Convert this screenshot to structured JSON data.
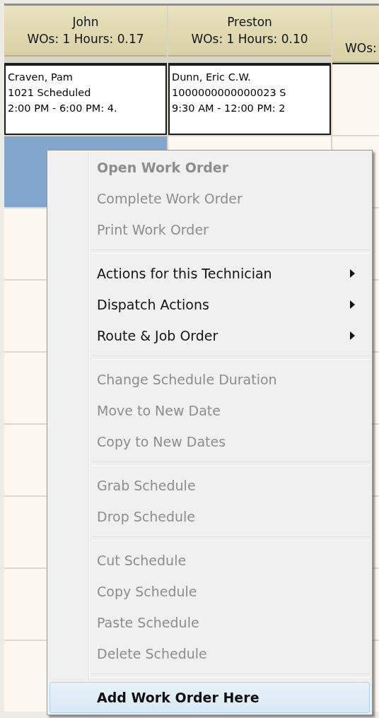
{
  "columns": [
    {
      "name": "John",
      "summary": "WOs: 1 Hours: 0.17"
    },
    {
      "name": "Preston",
      "summary": "WOs: 1 Hours: 0.10"
    },
    {
      "summary": "WOs:"
    }
  ],
  "job_row": [
    {
      "lines": [
        "Craven, Pam",
        "1021 Scheduled",
        "2:00 PM - 6:00 PM: 4."
      ]
    },
    {
      "lines": [
        "Dunn, Eric C.W.",
        "1000000000000023 S",
        "9:30 AM - 12:00 PM: 2"
      ]
    }
  ],
  "slot_rows": [
    {
      "cells": [
        {
          "selected": true
        },
        {
          "selected": false
        },
        {
          "selected": false
        }
      ]
    },
    {
      "cells": [
        {
          "selected": false
        },
        {
          "selected": false
        }
      ]
    },
    {
      "cells": [
        {
          "selected": false
        },
        {
          "selected": false
        }
      ]
    },
    {
      "cells": [
        {
          "selected": false
        },
        {
          "selected": false
        }
      ]
    },
    {
      "cells": [
        {
          "selected": false
        },
        {
          "selected": false
        }
      ]
    },
    {
      "cells": [
        {
          "selected": false
        },
        {
          "selected": false
        }
      ]
    },
    {
      "cells": [
        {
          "selected": false
        },
        {
          "selected": false
        }
      ]
    },
    {
      "cells": [
        {
          "selected": false
        },
        {
          "selected": false
        }
      ]
    }
  ],
  "context_menu": [
    {
      "kind": "item",
      "label": "Open Work Order",
      "disabled": true,
      "default": true,
      "submenu": false,
      "selected": false
    },
    {
      "kind": "item",
      "label": "Complete Work Order",
      "disabled": true,
      "default": false,
      "submenu": false,
      "selected": false
    },
    {
      "kind": "item",
      "label": "Print Work Order",
      "disabled": true,
      "default": false,
      "submenu": false,
      "selected": false
    },
    {
      "kind": "separator"
    },
    {
      "kind": "item",
      "label": "Actions for this Technician",
      "disabled": false,
      "default": false,
      "submenu": true,
      "selected": false
    },
    {
      "kind": "item",
      "label": "Dispatch Actions",
      "disabled": false,
      "default": false,
      "submenu": true,
      "selected": false
    },
    {
      "kind": "item",
      "label": "Route & Job Order",
      "disabled": false,
      "default": false,
      "submenu": true,
      "selected": false
    },
    {
      "kind": "separator"
    },
    {
      "kind": "item",
      "label": "Change Schedule Duration",
      "disabled": true,
      "default": false,
      "submenu": false,
      "selected": false
    },
    {
      "kind": "item",
      "label": "Move to New Date",
      "disabled": true,
      "default": false,
      "submenu": false,
      "selected": false
    },
    {
      "kind": "item",
      "label": "Copy to New Dates",
      "disabled": true,
      "default": false,
      "submenu": false,
      "selected": false
    },
    {
      "kind": "separator"
    },
    {
      "kind": "item",
      "label": "Grab Schedule",
      "disabled": true,
      "default": false,
      "submenu": false,
      "selected": false
    },
    {
      "kind": "item",
      "label": "Drop Schedule",
      "disabled": true,
      "default": false,
      "submenu": false,
      "selected": false
    },
    {
      "kind": "separator"
    },
    {
      "kind": "item",
      "label": "Cut Schedule",
      "disabled": true,
      "default": false,
      "submenu": false,
      "selected": false
    },
    {
      "kind": "item",
      "label": "Copy Schedule",
      "disabled": true,
      "default": false,
      "submenu": false,
      "selected": false
    },
    {
      "kind": "item",
      "label": "Paste Schedule",
      "disabled": true,
      "default": false,
      "submenu": false,
      "selected": false
    },
    {
      "kind": "item",
      "label": "Delete Schedule",
      "disabled": true,
      "default": false,
      "submenu": false,
      "selected": false
    },
    {
      "kind": "separator"
    },
    {
      "kind": "item",
      "label": "Add Work Order Here",
      "disabled": false,
      "default": true,
      "submenu": false,
      "selected": true
    }
  ]
}
